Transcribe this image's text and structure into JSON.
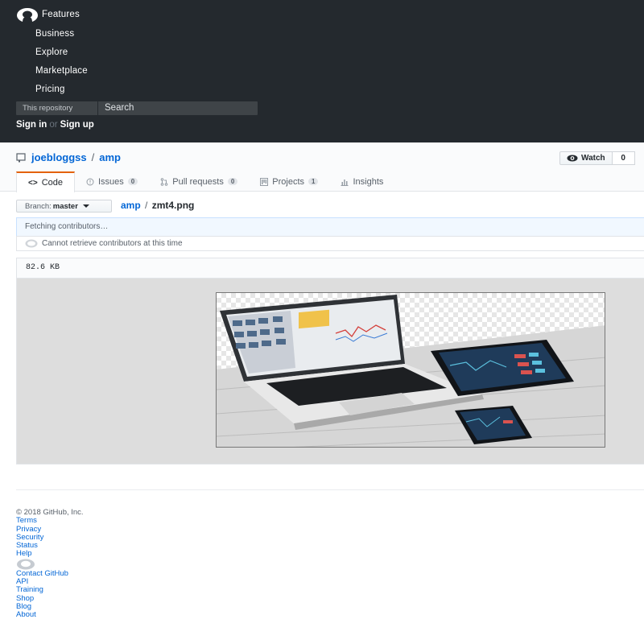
{
  "header": {
    "nav": [
      "Features",
      "Business",
      "Explore",
      "Marketplace",
      "Pricing"
    ],
    "search": {
      "scope": "This repository",
      "placeholder": "Search"
    },
    "sign_in": "Sign in",
    "or": "or",
    "sign_up": "Sign up"
  },
  "repo": {
    "owner": "joebloggss",
    "separator": "/",
    "name": "amp",
    "watch_label": "Watch",
    "watch_count": "0"
  },
  "tabs": [
    {
      "label": "Code",
      "icon": "code-icon",
      "selected": true
    },
    {
      "label": "Issues",
      "icon": "issue-icon",
      "count": "0"
    },
    {
      "label": "Pull requests",
      "icon": "pull-request-icon",
      "count": "0"
    },
    {
      "label": "Projects",
      "icon": "project-icon",
      "count": "1"
    },
    {
      "label": "Insights",
      "icon": "graph-icon"
    }
  ],
  "file_nav": {
    "branch_label": "Branch:",
    "branch": "master",
    "path_repo": "amp",
    "path_sep": "/",
    "path_file": "zmt4.png"
  },
  "contributors": {
    "fetching": "Fetching contributors…",
    "error": "Cannot retrieve contributors at this time"
  },
  "file": {
    "size": "82.6 KB",
    "image_icon": "laptop-tablet-phone-image"
  },
  "footer": {
    "copyright": "© 2018 GitHub, Inc.",
    "links_left": [
      "Terms",
      "Privacy",
      "Security",
      "Status",
      "Help"
    ],
    "links_right": [
      "Contact GitHub",
      "API",
      "Training",
      "Shop",
      "Blog",
      "About"
    ]
  },
  "colors": {
    "header_bg": "#24292e",
    "link": "#0366d6",
    "tab_accent": "#e36209"
  }
}
